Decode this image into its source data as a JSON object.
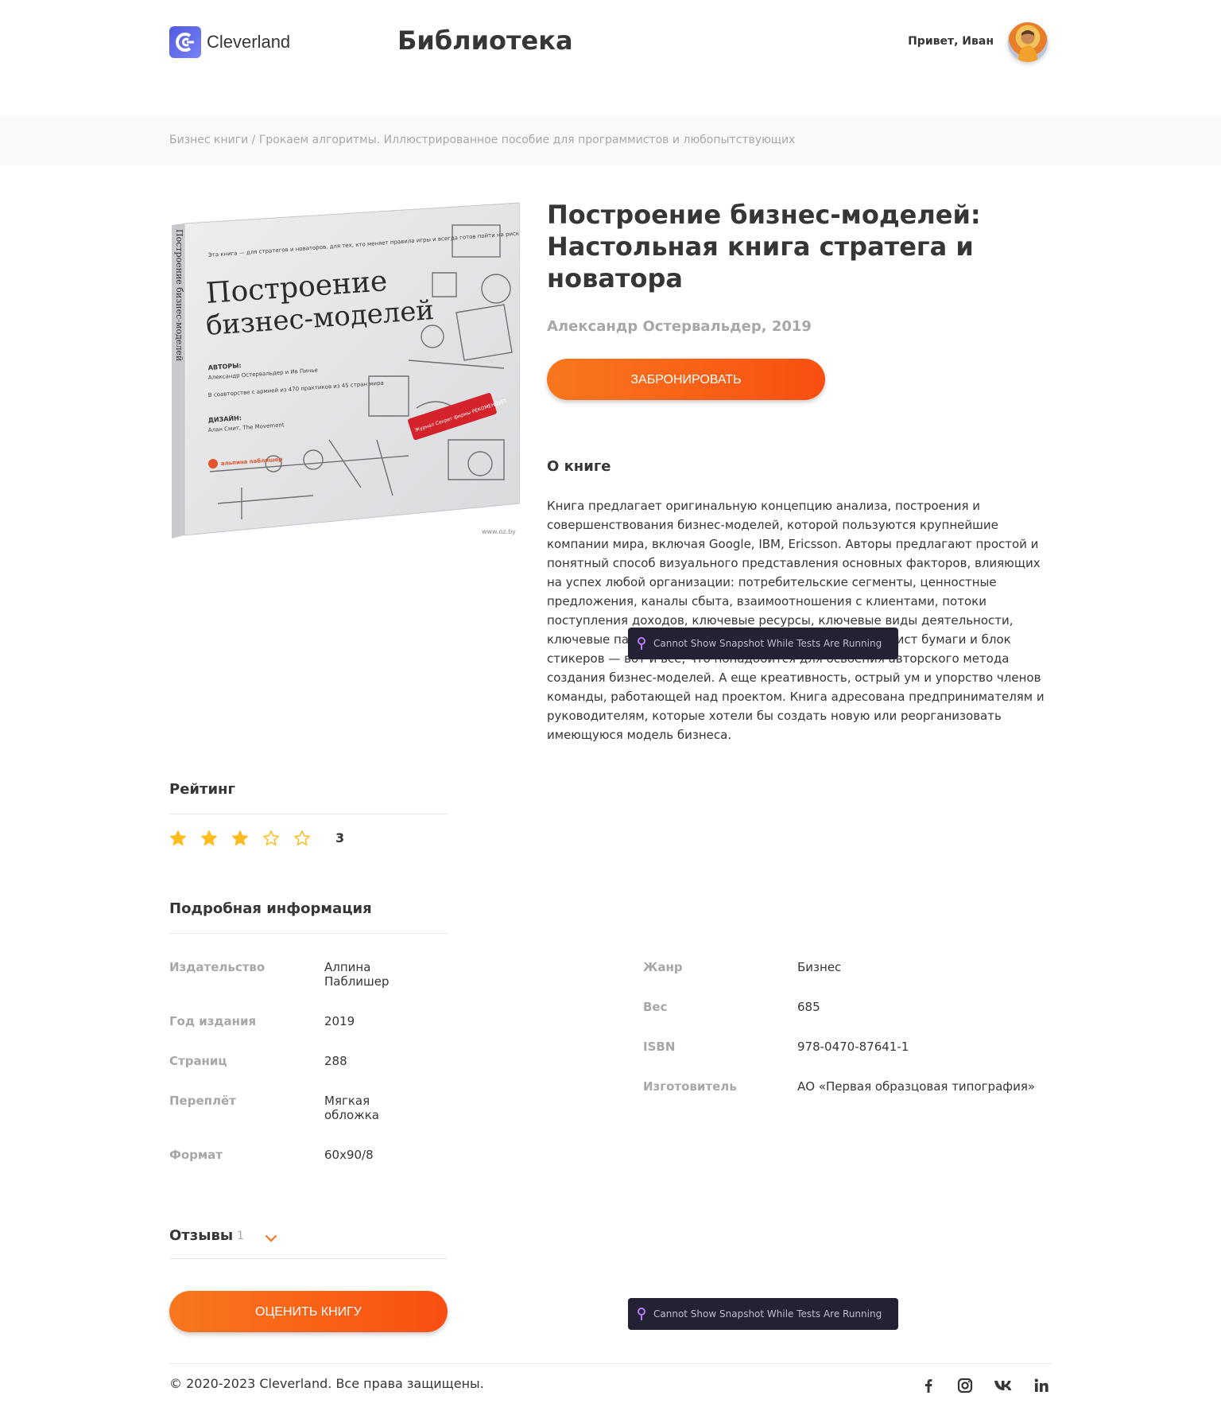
{
  "header": {
    "logo_text": "Cleverland",
    "page_title": "Библиотека",
    "greeting": "Привет, Иван"
  },
  "breadcrumbs": "Бизнес книги / Грокаем алгоритмы. Иллюстрированное пособие для программистов и любопытствующих",
  "book": {
    "title": "Построение бизнес-моделей: Настольная книга стратега и новатора",
    "author_year": "Александр Остервальдер, 2019",
    "reserve_label": "ЗАБРОНИРОВАТЬ",
    "about_heading": "О книге",
    "about_text": "Книга предлагает оригинальную концепцию анализа, построения и совершенствования бизнес-моделей, которой пользуются крупнейшие компании мира, включая Google, IBM, Ericsson. Авторы предлагают простой и понятный способ визуального представления основных факторов, влияющих на успех любой организации: потребительские сегменты, ценностные предложения, каналы сбыта, взаимоотношения с клиентами, потоки поступления доходов, ключевые ресурсы, ключевые виды деятельности, ключевые партнеры и структура издержек. Большой лист бумаги и блок стикеров — вот и все, что понадобится для освоения авторского метода создания бизнес-моделей. А еще креативность, острый ум и упорство членов команды, работающей над проектом. Книга адресована предпринимателям и руководителям, которые хотели бы создать новую или реорганизовать имеющуюся модель бизнеса.",
    "cover": {
      "title_line1": "Построение",
      "title_line2": "бизнес-моделей",
      "blurb": "Эта книга — для стратегов и новаторов, для тех, кто меняет правила игры и всегда готов пойти на риск ради разрушения устаревших бизнес-моделей и построения предприятий будущего",
      "authors_label": "АВТОРЫ:",
      "authors": "Александр Остервальдер и Ив Пинье",
      "coauthors": "В соавторстве с армией из 470 практиков из 45 стран мира",
      "design_label": "ДИЗАЙН:",
      "design": "Алан Смит, The Movement",
      "publisher_logo": "альпина паблишер",
      "badge": "Журнал Секрет фирмы РЕКОМЕНДУЕТ",
      "spine": "Построение бизнес-моделей",
      "watermark": "www.oz.by"
    }
  },
  "rating": {
    "heading": "Рейтинг",
    "value": 3,
    "max": 5,
    "value_text": "3"
  },
  "details": {
    "heading": "Подробная информация",
    "left": [
      {
        "key": "Издательство",
        "value": "Алпина Паблишер"
      },
      {
        "key": "Год издания",
        "value": "2019"
      },
      {
        "key": "Страниц",
        "value": "288"
      },
      {
        "key": "Переплёт",
        "value": "Мягкая обложка"
      },
      {
        "key": "Формат",
        "value": "60х90/8"
      }
    ],
    "right": [
      {
        "key": "Жанр",
        "value": "Бизнес"
      },
      {
        "key": "Вес",
        "value": "685"
      },
      {
        "key": "ISBN",
        "value": "978-0470-87641-1"
      },
      {
        "key": "Изготовитель",
        "value": "АО «Первая образцовая типография»"
      }
    ]
  },
  "reviews": {
    "heading": "Отзывы",
    "count": "1",
    "rate_button": "ОЦЕНИТЬ КНИГУ"
  },
  "tooltip": {
    "text": "Cannot Show Snapshot While Tests Are Running"
  },
  "footer": {
    "copyright": "© 2020-2023 Cleverland. Все права защищены."
  },
  "colors": {
    "accent_start": "#f8771e",
    "accent_end": "#f94f11",
    "star": "#ffbc1f",
    "muted": "#a7a7a7",
    "logo": "#4f5ae3"
  },
  "icons": [
    "facebook-icon",
    "instagram-icon",
    "vk-icon",
    "linkedin-icon"
  ]
}
